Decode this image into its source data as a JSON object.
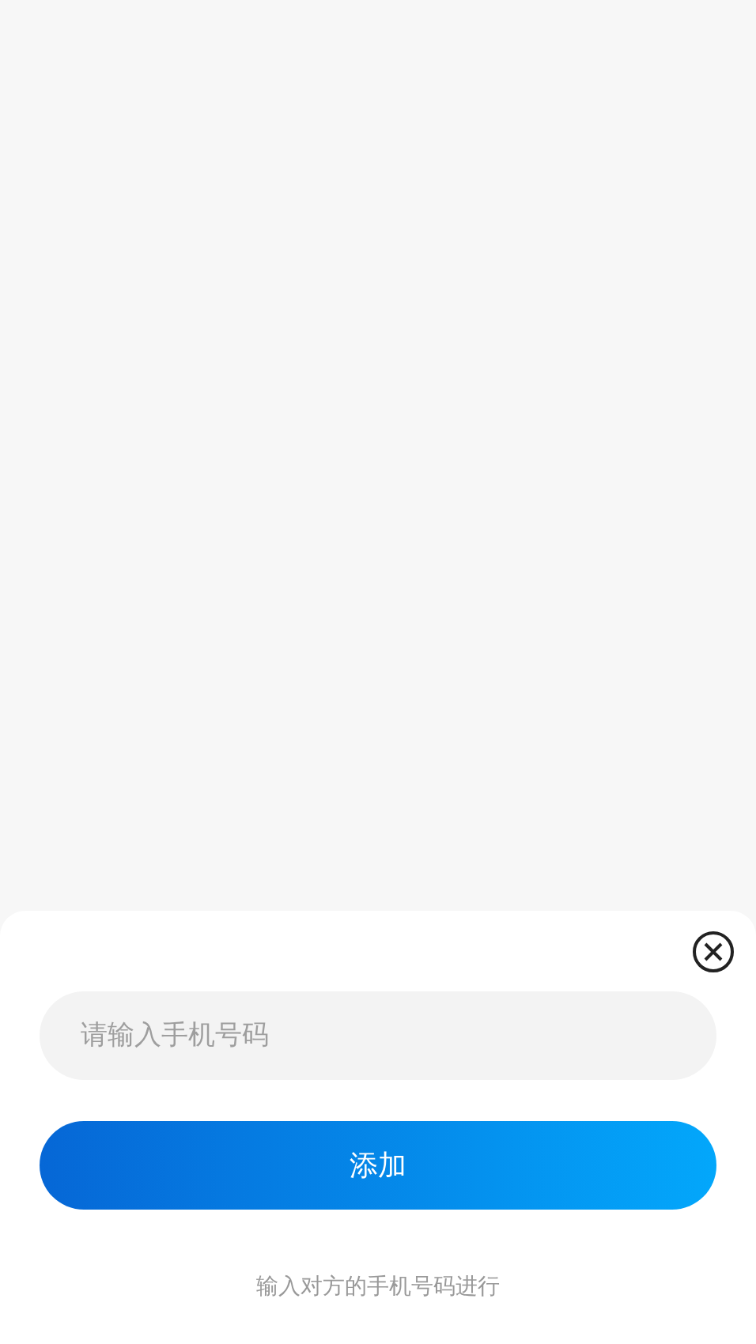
{
  "sheet": {
    "phone_field": {
      "placeholder": "请输入手机号码"
    },
    "add_button": {
      "label": "添加"
    },
    "hint": "输入对方的手机号码进行"
  }
}
